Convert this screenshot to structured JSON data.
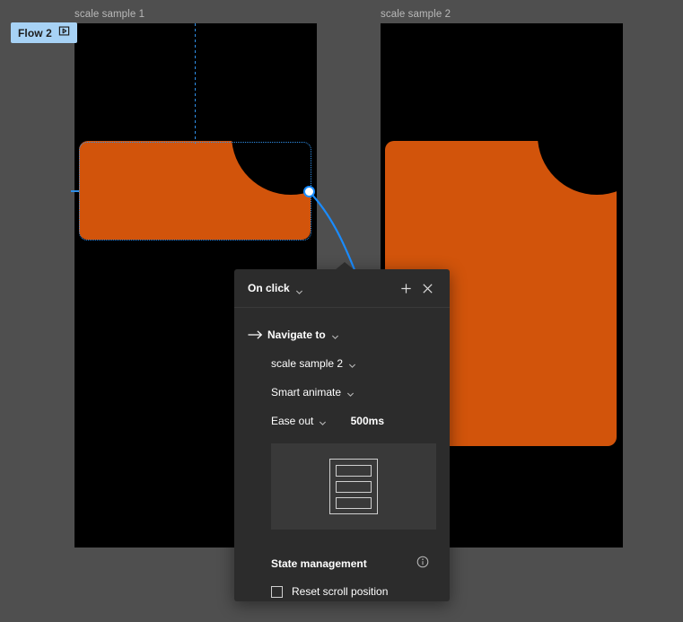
{
  "canvas": {
    "background_color": "#4f4f4f",
    "frames": [
      {
        "label": "scale sample 1",
        "background_color": "#000000",
        "shape_color": "#d2540b",
        "selected": true
      },
      {
        "label": "scale sample 2",
        "background_color": "#000000",
        "shape_color": "#d2540b",
        "selected": false
      }
    ],
    "selection_color": "#2f8fe8",
    "connection_color": "#1a8cff"
  },
  "flow_badge": {
    "label": "Flow 2",
    "icon": "flow-start-icon",
    "background_color": "#a7d2f5"
  },
  "panel": {
    "header": {
      "trigger_label": "On click",
      "trigger_chevron_icon": "chevron-down-icon",
      "add_icon": "plus-icon",
      "close_icon": "close-icon"
    },
    "action": {
      "arrow_icon": "arrow-right-icon",
      "action_label": "Navigate to",
      "action_chevron_icon": "chevron-down-icon",
      "destination_label": "scale sample 2",
      "destination_chevron_icon": "chevron-down-icon",
      "animation_label": "Smart animate",
      "animation_chevron_icon": "chevron-down-icon",
      "easing_label": "Ease out",
      "easing_chevron_icon": "chevron-down-icon",
      "duration_value": "500ms"
    },
    "preview": {
      "icon": "document-list-icon",
      "background_color": "#393939"
    },
    "state_management": {
      "title": "State management",
      "info_icon": "info-icon",
      "reset_scroll_label": "Reset scroll position",
      "reset_scroll_checked": false
    }
  }
}
